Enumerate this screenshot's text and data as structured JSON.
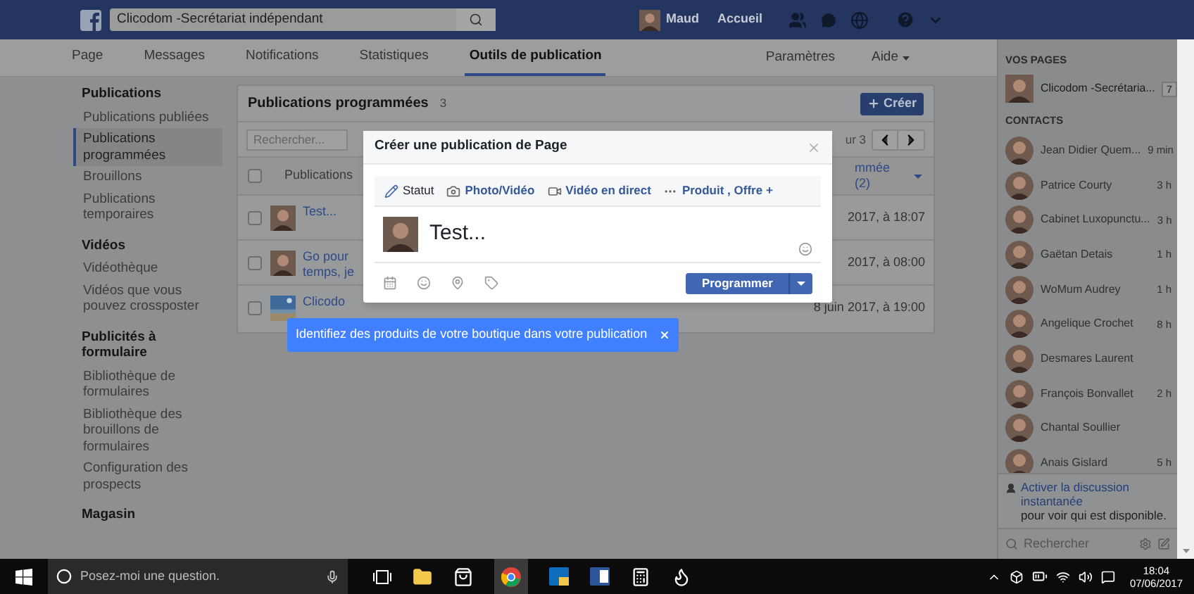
{
  "top_bar": {
    "search_value": "Clicodom -Secrétariat indépendant",
    "user_name": "Maud",
    "home_link": "Accueil"
  },
  "page_tabs": [
    {
      "label": "Page",
      "selected": false
    },
    {
      "label": "Messages",
      "selected": false
    },
    {
      "label": "Notifications",
      "selected": false
    },
    {
      "label": "Statistiques",
      "selected": false
    },
    {
      "label": "Outils de publication",
      "selected": true
    }
  ],
  "page_menu": [
    {
      "label": "Paramètres",
      "kind": "link"
    },
    {
      "label": "Aide",
      "kind": "dropdown"
    }
  ],
  "left_nav": [
    {
      "title": "Publications",
      "items": [
        {
          "label": "Publications publiées",
          "selected": false
        },
        {
          "label": "Publications programmées",
          "selected": true
        },
        {
          "label": "Brouillons",
          "selected": false
        },
        {
          "label": "Publications temporaires",
          "selected": false
        }
      ]
    },
    {
      "title": "Vidéos",
      "items": [
        {
          "label": "Vidéothèque",
          "selected": false
        },
        {
          "label": "Vidéos que vous pouvez crossposter",
          "selected": false
        }
      ]
    },
    {
      "title": "Publicités à formulaire",
      "items": [
        {
          "label": "Bibliothèque de formulaires",
          "selected": false
        },
        {
          "label": "Bibliothèque des brouillons de formulaires",
          "selected": false
        },
        {
          "label": "Configuration des prospects",
          "selected": false
        }
      ]
    },
    {
      "title": "Magasin"
    }
  ],
  "scheduled_posts": {
    "title": "Publications programmées",
    "count": "3",
    "create_button": "Créer",
    "search": {
      "placeholder": "Rechercher..."
    },
    "pager_label": "ur 3",
    "header_checked": false,
    "columns": [
      "Publications",
      "mmée (2)"
    ],
    "rows": [
      {
        "kind": "avatar",
        "text": "Test...",
        "date": "2017, à 18:07",
        "checked": false
      },
      {
        "kind": "avatar",
        "text": "Go pour temps, je",
        "date": "2017, à 08:00",
        "checked": false
      },
      {
        "kind": "picture",
        "text": "Clicodo",
        "date": "8 juin 2017, à 19:00",
        "checked": false
      }
    ]
  },
  "composer": {
    "title": "Créer une publication de Page",
    "tabs": [
      {
        "label": "Statut",
        "selected": true
      },
      {
        "label": "Photo/Vidéo",
        "selected": false
      },
      {
        "label": "Vidéo en direct",
        "selected": false
      },
      {
        "label": "Produit , Offre +",
        "selected": false
      }
    ],
    "text": "Test...",
    "submit": "Programmer"
  },
  "tooltip": {
    "text": "Identifiez des produits de votre boutique dans votre publication"
  },
  "right_sidebar": {
    "pages_heading": "VOS PAGES",
    "pages": [
      {
        "name": "Clicodom -Secrétaria...",
        "badge": "7"
      }
    ],
    "contacts_heading": "CONTACTS",
    "contacts": [
      {
        "name": "Jean Didier Quem...",
        "time": "9 min"
      },
      {
        "name": "Patrice Courty",
        "time": "3 h"
      },
      {
        "name": "Cabinet Luxopunctu...",
        "time": "3 h"
      },
      {
        "name": "Gaëtan Detais",
        "time": "1 h"
      },
      {
        "name": "WoMum Audrey",
        "time": "1 h"
      },
      {
        "name": "Angelique Crochet",
        "time": "8 h"
      },
      {
        "name": "Desmares Laurent"
      },
      {
        "name": "François Bonvallet",
        "time": "2 h"
      },
      {
        "name": "Chantal Soullier"
      },
      {
        "name": "Anais Gislard",
        "time": "5 h"
      }
    ],
    "notice_link": "Activer la discussion instantanée",
    "notice_text": "pour voir qui est disponible.",
    "search_placeholder": "Rechercher"
  },
  "taskbar": {
    "search_placeholder": "Posez-moi une question.",
    "time": "18:04",
    "date": "07/06/2017"
  }
}
